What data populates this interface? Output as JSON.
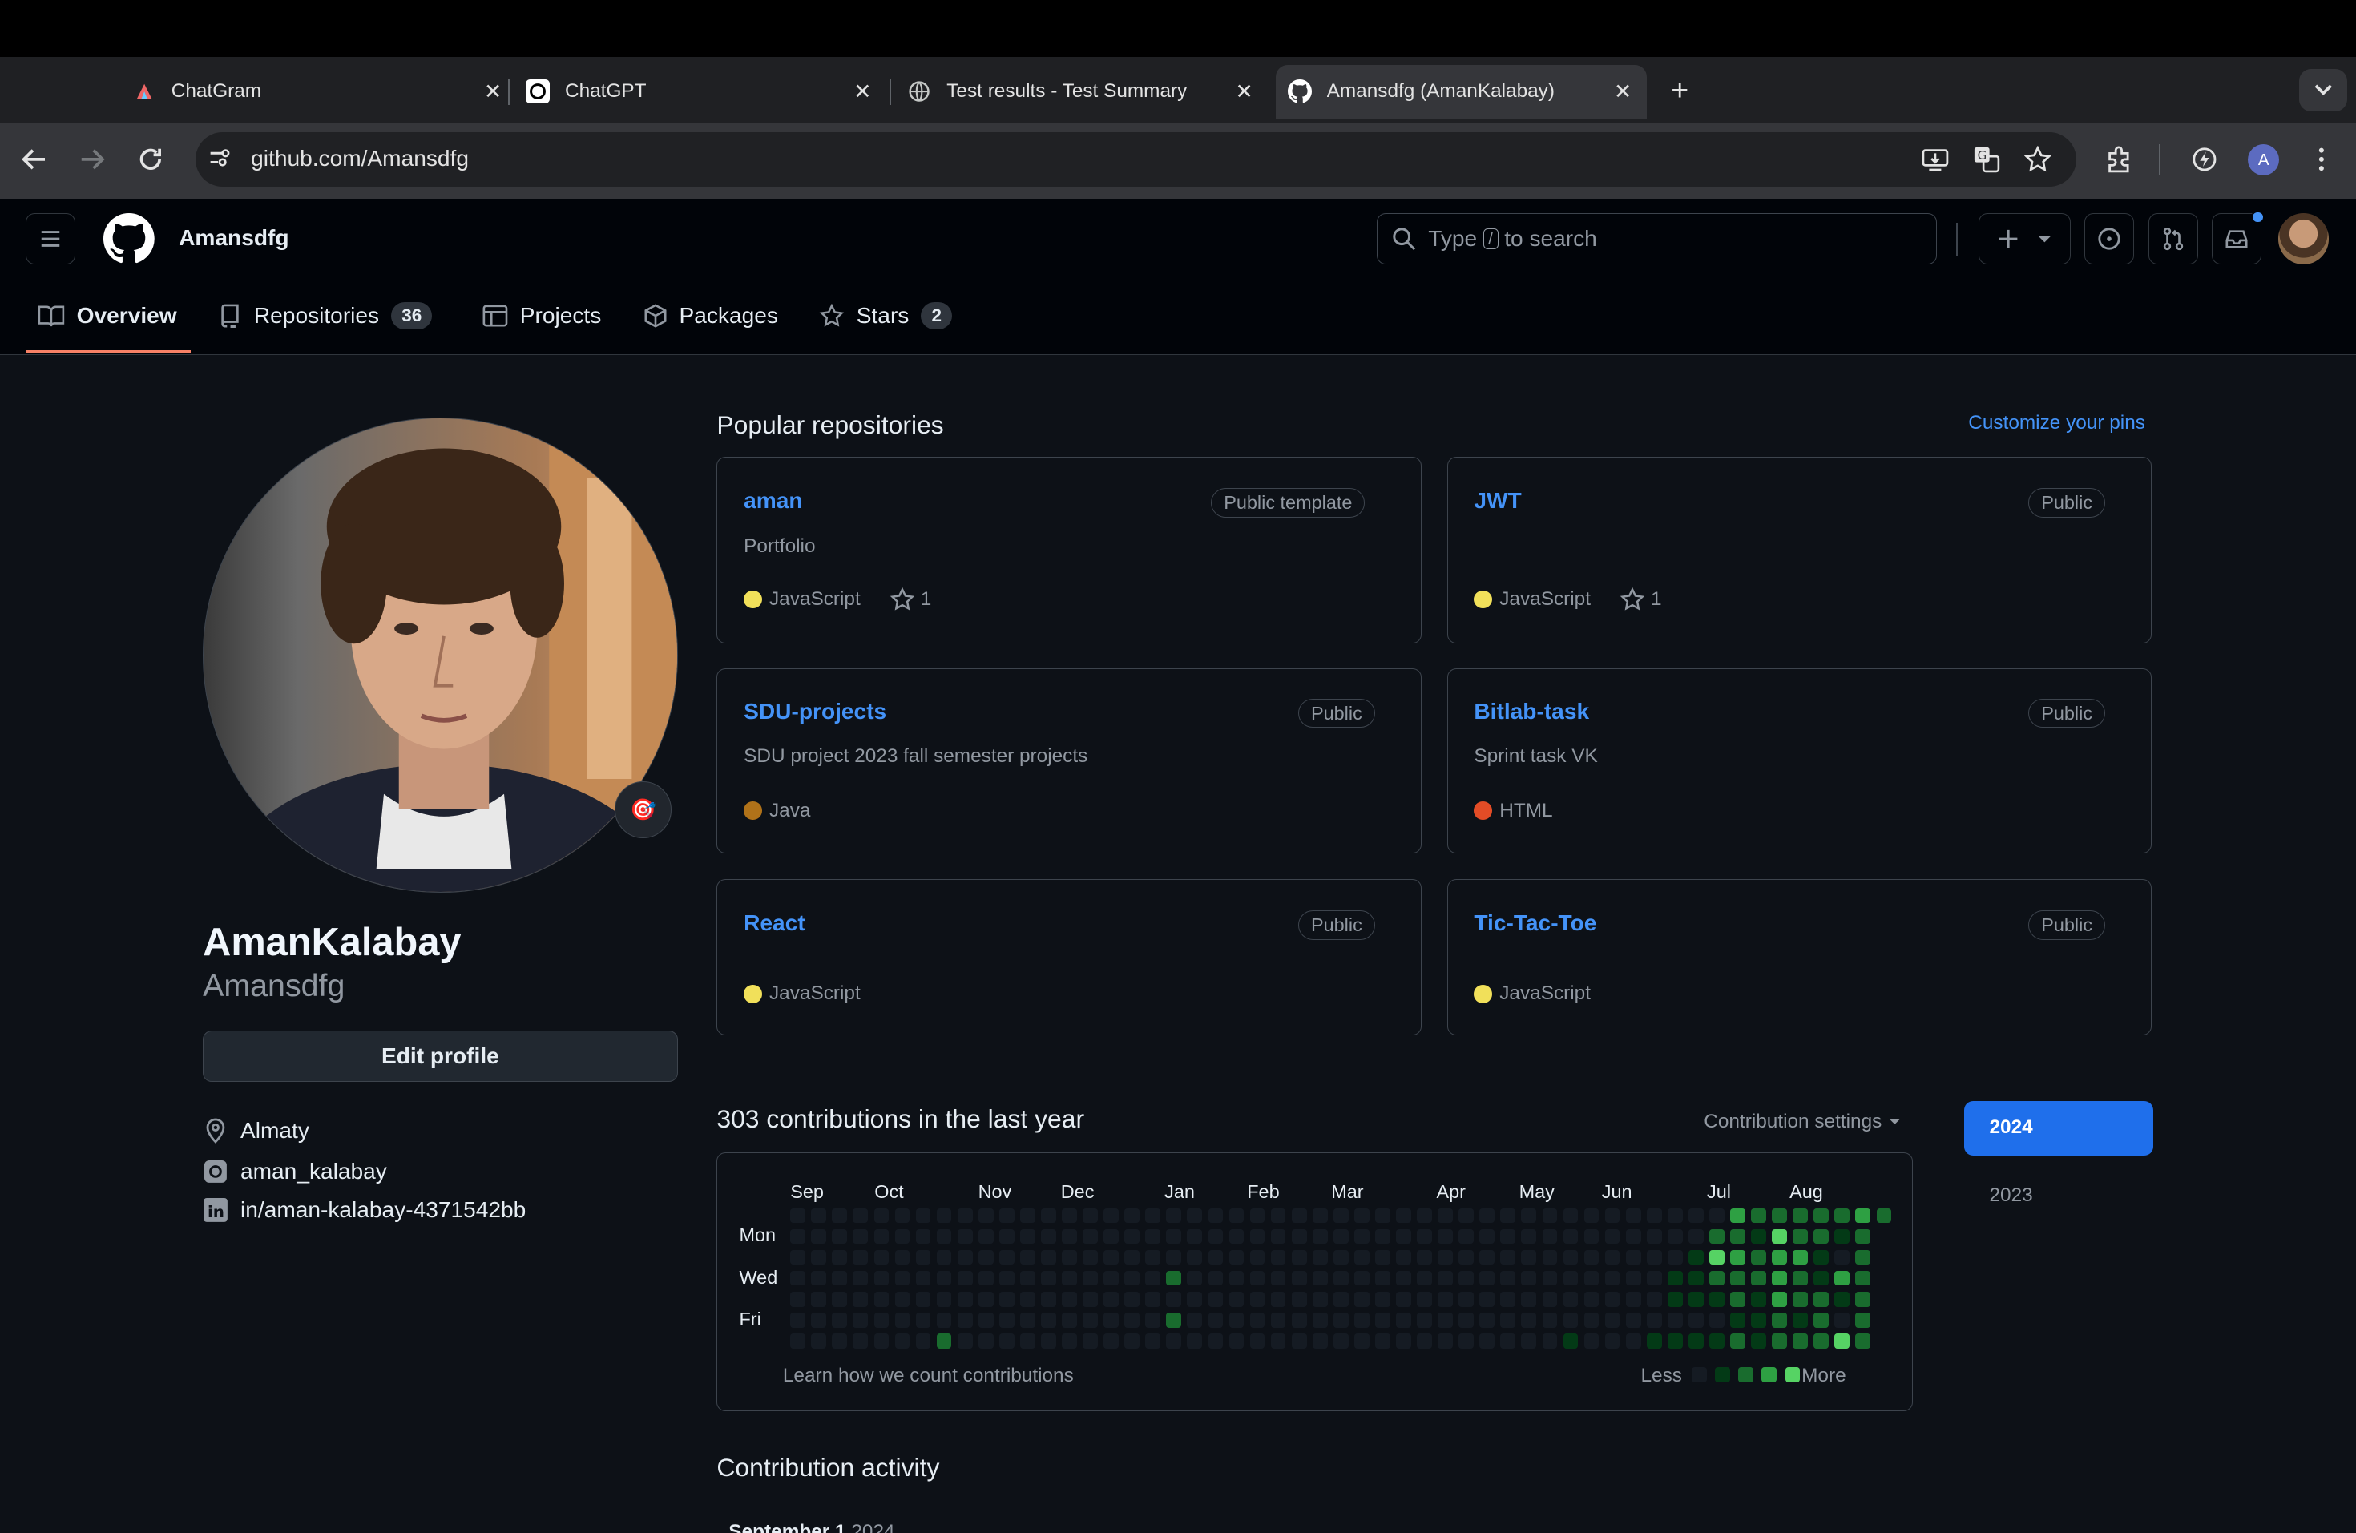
{
  "browser": {
    "tabs": [
      {
        "title": "ChatGram"
      },
      {
        "title": "ChatGPT"
      },
      {
        "title": "Test results - Test Summary"
      },
      {
        "title": "Amansdfg (AmanKalabay)"
      }
    ],
    "url": "github.com/Amansdfg",
    "profile_initial": "A"
  },
  "header": {
    "username": "Amansdfg",
    "search_prefix": "Type",
    "search_key": "/",
    "search_suffix": "to search"
  },
  "nav": {
    "overview": "Overview",
    "repositories": "Repositories",
    "repositories_count": "36",
    "projects": "Projects",
    "packages": "Packages",
    "stars": "Stars",
    "stars_count": "2"
  },
  "profile": {
    "name": "AmanKalabay",
    "login": "Amansdfg",
    "status_emoji": "🎯",
    "edit_button": "Edit profile",
    "location": "Almaty",
    "instagram": "aman_kalabay",
    "linkedin": "in/aman-kalabay-4371542bb"
  },
  "popular": {
    "title": "Popular repositories",
    "customize": "Customize your pins",
    "repos": [
      {
        "name": "aman",
        "badge": "Public template",
        "desc": "Portfolio",
        "lang": "JavaScript",
        "color": "#f1e05a",
        "stars": "1"
      },
      {
        "name": "JWT",
        "badge": "Public",
        "desc": "",
        "lang": "JavaScript",
        "color": "#f1e05a",
        "stars": "1"
      },
      {
        "name": "SDU-projects",
        "badge": "Public",
        "desc": "SDU project 2023 fall semester projects",
        "lang": "Java",
        "color": "#b07219",
        "stars": ""
      },
      {
        "name": "Bitlab-task",
        "badge": "Public",
        "desc": "Sprint task VK",
        "lang": "HTML",
        "color": "#e34c26",
        "stars": ""
      },
      {
        "name": "React",
        "badge": "Public",
        "desc": "",
        "lang": "JavaScript",
        "color": "#f1e05a",
        "stars": ""
      },
      {
        "name": "Tic-Tac-Toe",
        "badge": "Public",
        "desc": "",
        "lang": "JavaScript",
        "color": "#f1e05a",
        "stars": ""
      }
    ]
  },
  "contributions": {
    "title": "303 contributions in the last year",
    "settings": "Contribution settings",
    "months": [
      "Sep",
      "Oct",
      "Nov",
      "Dec",
      "Jan",
      "Feb",
      "Mar",
      "Apr",
      "May",
      "Jun",
      "Jul",
      "Aug"
    ],
    "days": [
      "Mon",
      "Wed",
      "Fri"
    ],
    "learn": "Learn how we count contributions",
    "less": "Less",
    "more": "More",
    "years": [
      "2024",
      "2023"
    ],
    "palette": [
      "#151b23",
      "#033a16",
      "#196c2e",
      "#2ea043",
      "#56d364"
    ]
  },
  "activity": {
    "title": "Contribution activity",
    "period_month": "September 1",
    "period_year": "2024"
  }
}
